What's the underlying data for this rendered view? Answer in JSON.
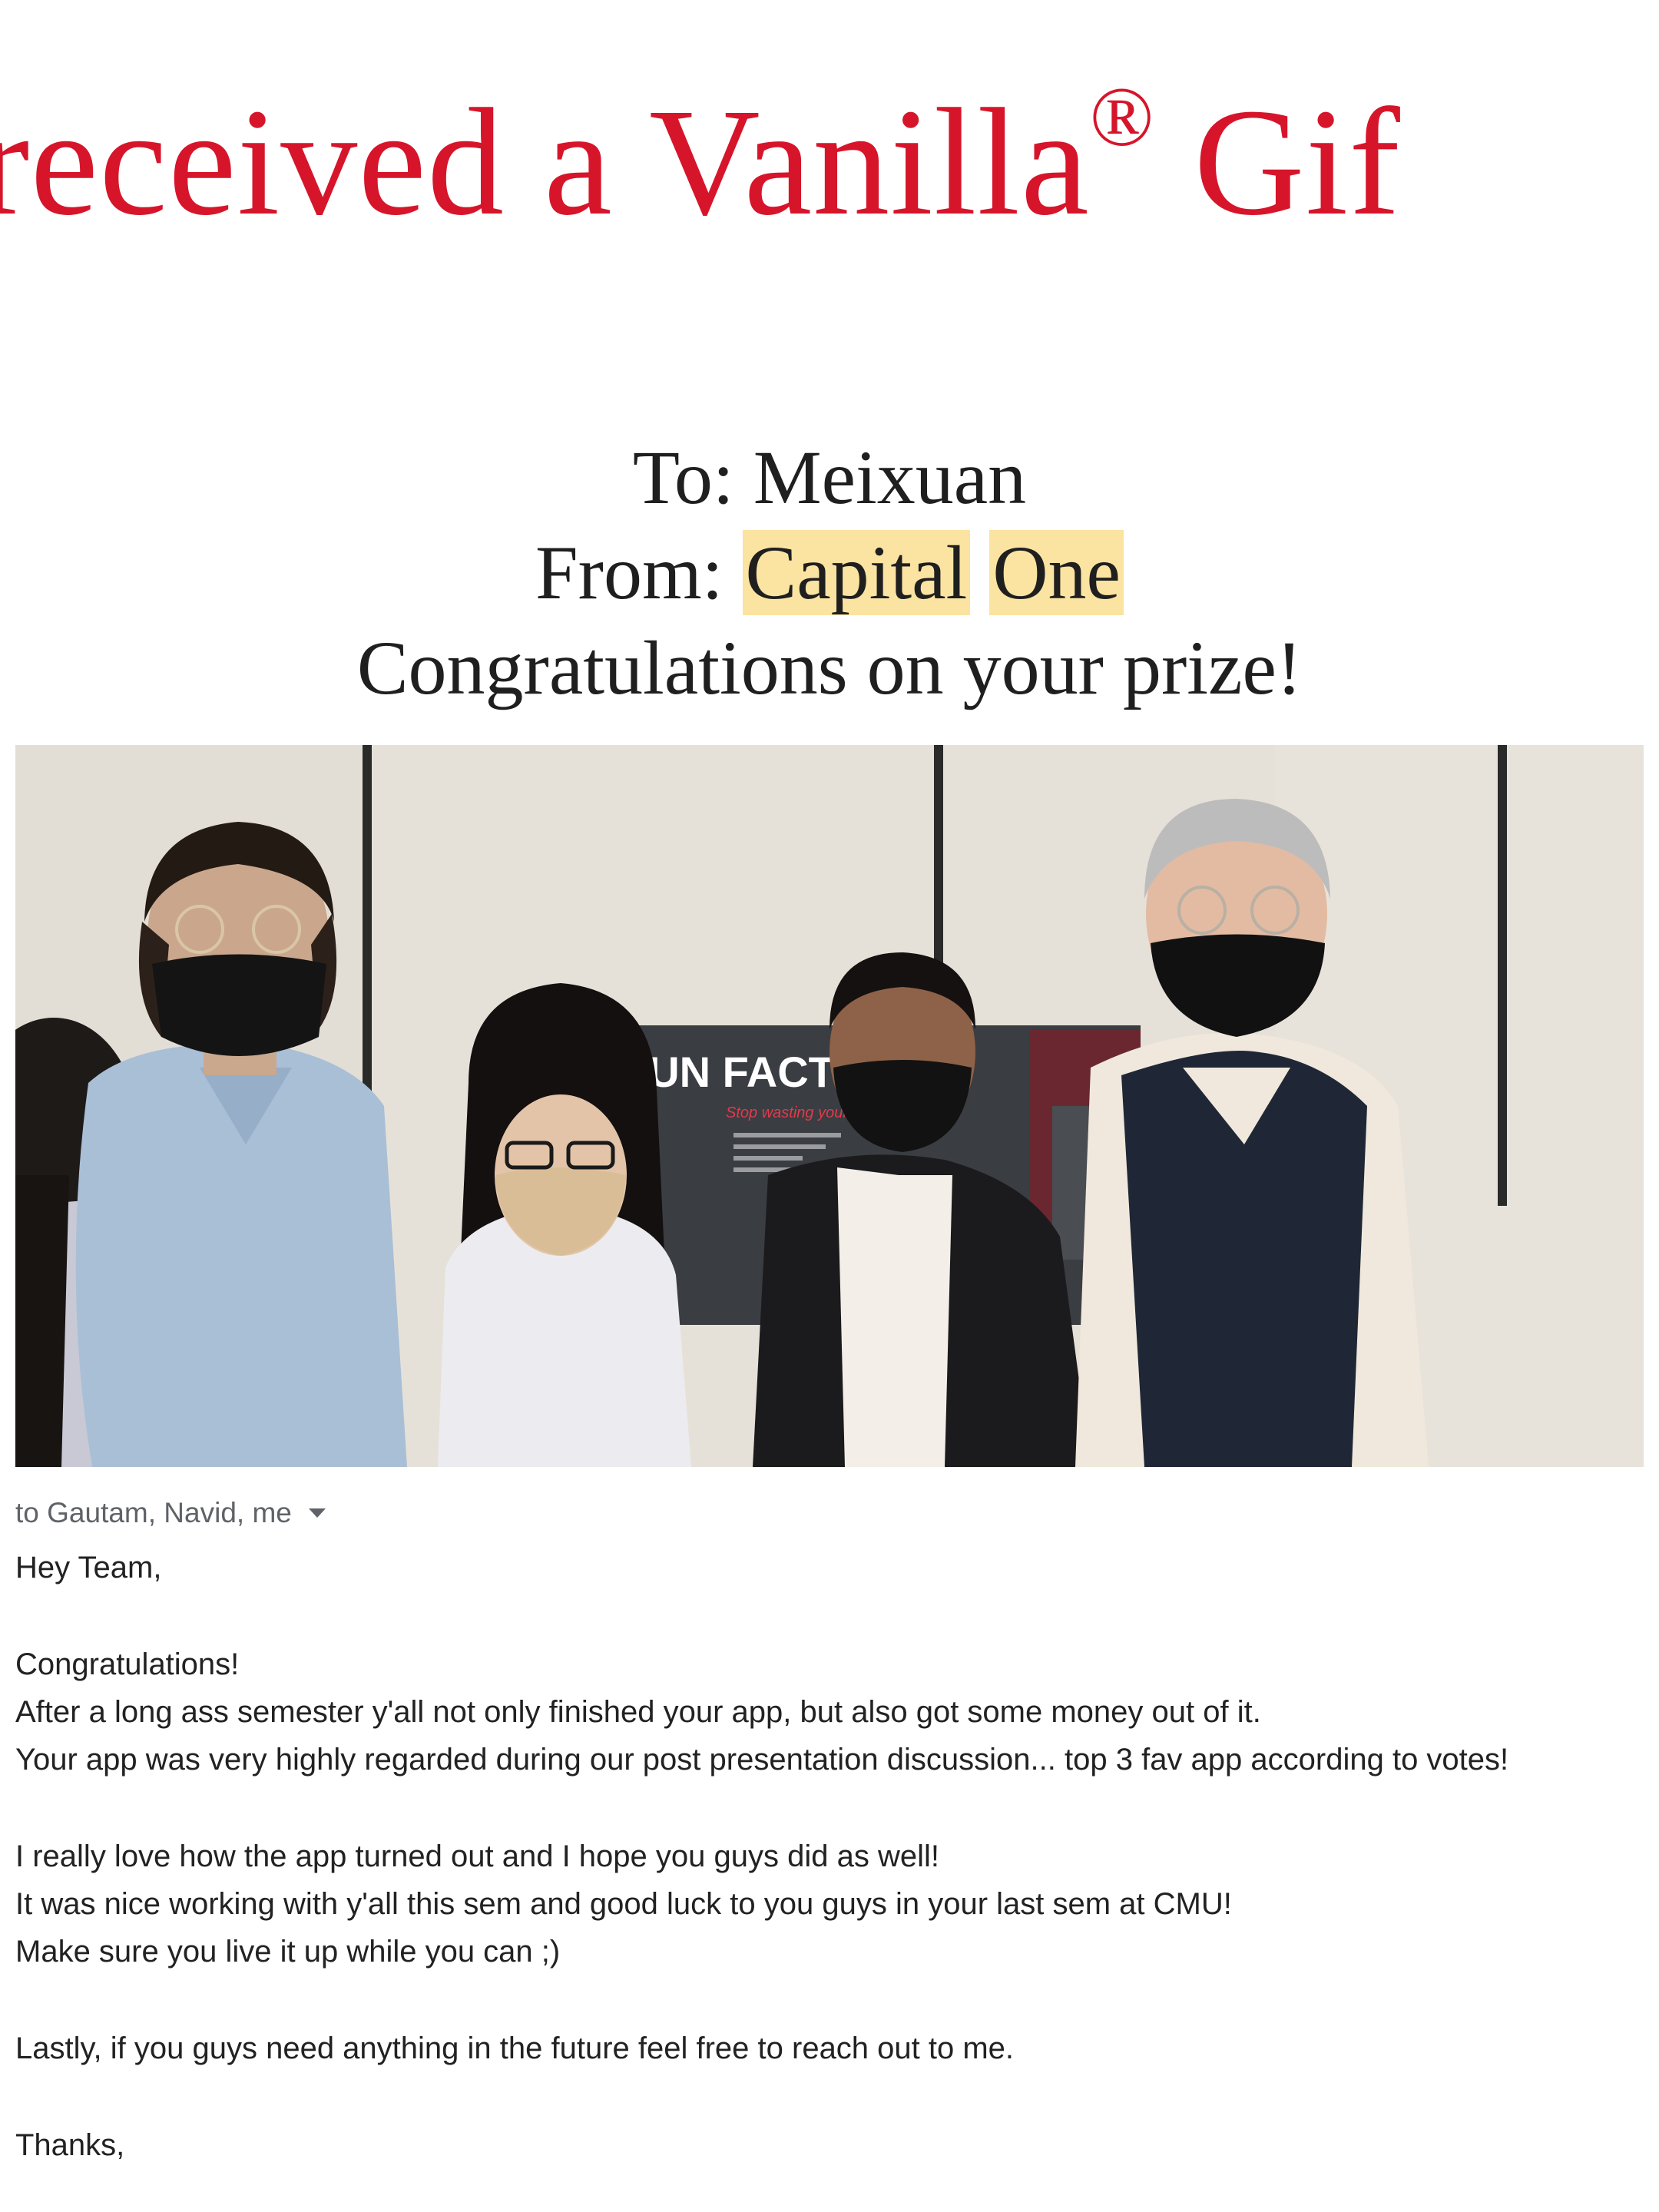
{
  "headline": {
    "text_before": "ve received a Vanilla",
    "trademark": "®",
    "text_after": " Gif"
  },
  "card": {
    "to_line": "To: Meixuan",
    "from_label": "From: ",
    "from_word1": "Capital",
    "from_word2": "One",
    "message": "Congratulations on your prize!"
  },
  "photo": {
    "poster_title": "FUN FACTOR",
    "poster_tagline": "Stop wasting your time"
  },
  "email": {
    "recipients": "to Gautam, Navid, me",
    "greeting": "Hey Team,",
    "p1_l1": "Congratulations!",
    "p1_l2": "After a long ass semester y'all not only finished your app, but also got some money out of it.",
    "p1_l3": "Your app was very highly regarded during our post presentation discussion... top 3 fav app according to votes!",
    "p2_l1": "I really love how the app turned out and I hope you guys did as well!",
    "p2_l2": "It was nice working with y'all this sem and good luck to you guys in your last sem at CMU!",
    "p2_l3": "Make sure you live it up while you can ;)",
    "p3_l1": "Lastly, if you guys need anything in the future feel free to reach out to me.",
    "signoff": "Thanks,"
  },
  "colors": {
    "headline_red": "#d6152b",
    "highlight_yellow": "#fbe3a1",
    "meta_gray": "#5f6368"
  }
}
